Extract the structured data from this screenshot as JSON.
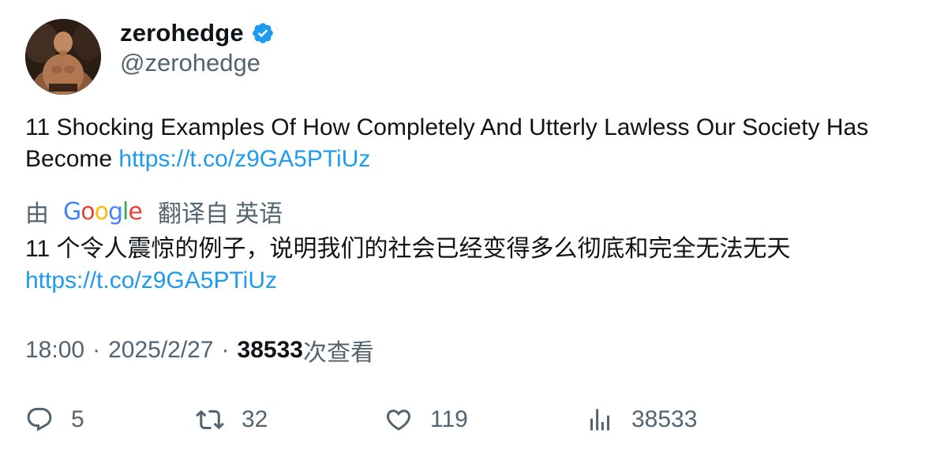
{
  "author": {
    "display_name": "zerohedge",
    "handle": "@zerohedge",
    "verified": true
  },
  "tweet": {
    "text": "11 Shocking Examples Of How Completely And Utterly Lawless Our Society Has Become ",
    "link": "https://t.co/z9GA5PTiUz"
  },
  "translation": {
    "by_label": "由",
    "provider": "Google",
    "from_label": "翻译自 英语",
    "text": "11 个令人震惊的例子，说明我们的社会已经变得多么彻底和完全无法无天",
    "link": "https://t.co/z9GA5PTiUz"
  },
  "meta": {
    "time": "18:00",
    "separator": "·",
    "date": "2025/2/27",
    "views_count": "38533",
    "views_label": "次查看"
  },
  "actions": {
    "reply_count": "5",
    "retweet_count": "32",
    "like_count": "119",
    "views_count": "38533"
  },
  "colors": {
    "link": "#1d9bf0",
    "muted": "#536471",
    "verified": "#1d9bf0"
  },
  "icons": {
    "reply": "reply-icon",
    "retweet": "retweet-icon",
    "like": "heart-icon",
    "views": "views-bar-chart-icon",
    "verified": "verified-badge-icon"
  }
}
